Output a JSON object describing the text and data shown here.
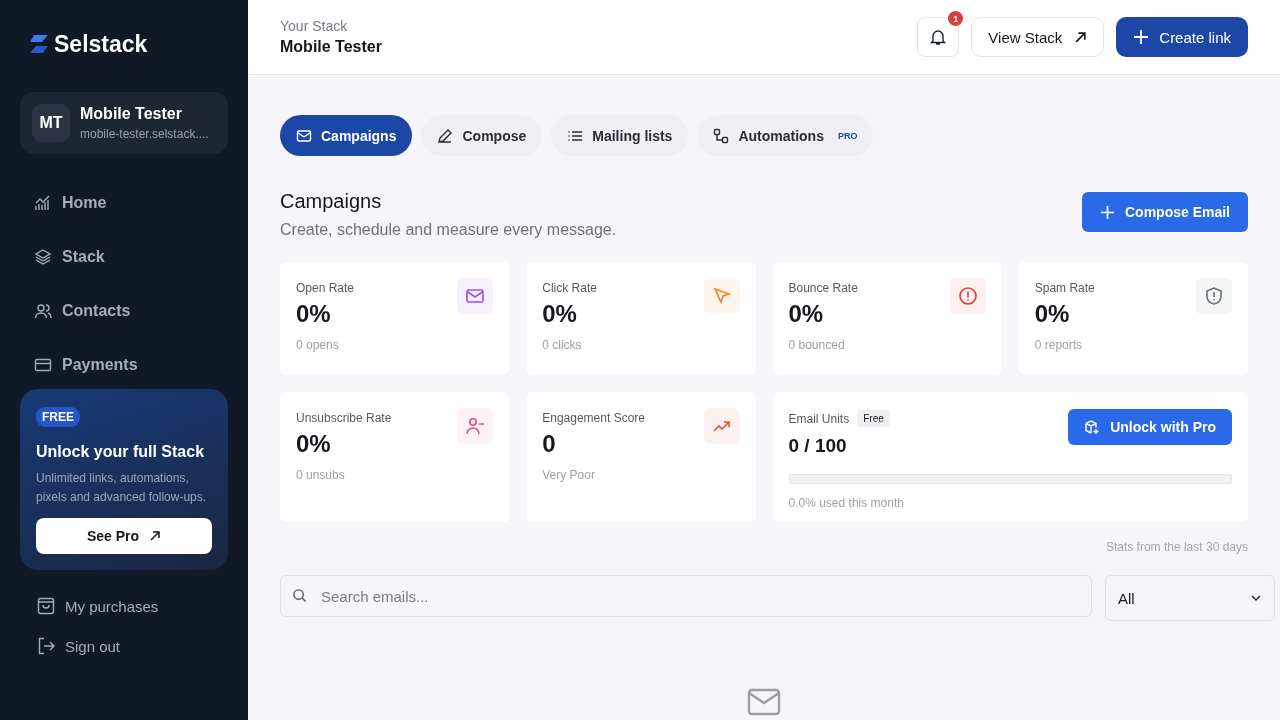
{
  "sidebar": {
    "logo": "Selstack",
    "profile": {
      "initials": "MT",
      "name": "Mobile Tester",
      "url": "mobile-tester.selstack...."
    },
    "nav": [
      {
        "label": "Home",
        "kind": "home",
        "selected": false
      },
      {
        "label": "Stack",
        "kind": "stack",
        "selected": false
      },
      {
        "label": "Contacts",
        "kind": "contacts",
        "selected": false
      },
      {
        "label": "Payments",
        "kind": "payments",
        "selected": false
      }
    ],
    "promo": {
      "badge": "FREE",
      "title": "Unlock your full Stack",
      "text": "Unlimited links, automations, pixels and advanced follow-ups.",
      "button": "See Pro"
    },
    "footer": [
      {
        "label": "My purchases",
        "kind": "bag"
      },
      {
        "label": "Sign out",
        "kind": "signout"
      }
    ]
  },
  "header": {
    "subtitle": "Your Stack",
    "title": "Mobile Tester",
    "notifications": "1",
    "view_button": "View Stack",
    "create_button": "Create link"
  },
  "tabs": [
    {
      "label": "Campaigns",
      "kind": "mail",
      "selected": true
    },
    {
      "label": "Compose",
      "kind": "pen",
      "selected": false
    },
    {
      "label": "Mailing lists",
      "kind": "list",
      "selected": false
    },
    {
      "label": "Automations",
      "kind": "flow",
      "selected": false,
      "badge": "PRO"
    }
  ],
  "section": {
    "title": "Campaigns",
    "subtitle": "Create, schedule and measure every message.",
    "button": "Compose Email"
  },
  "stats": [
    {
      "label": "Open Rate",
      "value": "0%",
      "note": "0 opens",
      "kind": "mail",
      "color": "#9b51e0"
    },
    {
      "label": "Click Rate",
      "value": "0%",
      "note": "0 clicks",
      "kind": "cursor",
      "color": "#f2801e"
    },
    {
      "label": "Bounce Rate",
      "value": "0%",
      "note": "0 bounced",
      "kind": "alert",
      "color": "#e03c3c"
    },
    {
      "label": "Spam Rate",
      "value": "0%",
      "note": "0 reports",
      "kind": "shield",
      "color": "#6b6f78"
    },
    {
      "label": "Unsubscribe Rate",
      "value": "0%",
      "note": "0 unsubs",
      "kind": "user-minus",
      "color": "#e0508a"
    },
    {
      "label": "Engagement Score",
      "value": "0",
      "note": "Very Poor",
      "kind": "trend",
      "color": "#e05040"
    }
  ],
  "units": {
    "label": "Email Units",
    "badge": "Free",
    "value": "0 / 100",
    "level": 0,
    "note": "0.0% used this month",
    "button": "Unlock with Pro"
  },
  "stats_note": "Stats from the last 30 days",
  "search": {
    "placeholder": "Search emails..."
  },
  "filter": {
    "value": "All"
  }
}
